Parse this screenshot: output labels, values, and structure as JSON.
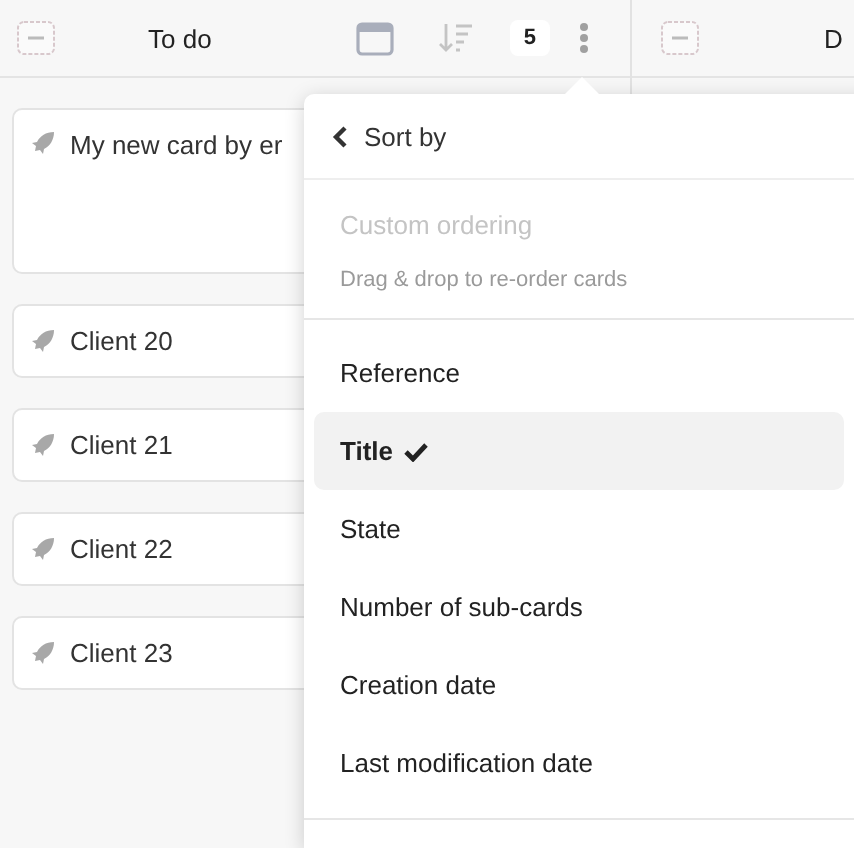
{
  "columns": [
    {
      "title": "To do",
      "count": "5",
      "cards": [
        {
          "title": "My new card by er",
          "tall": true
        },
        {
          "title": "Client 20",
          "tall": false
        },
        {
          "title": "Client 21",
          "tall": false
        },
        {
          "title": "Client 22",
          "tall": false
        },
        {
          "title": "Client 23",
          "tall": false
        }
      ]
    },
    {
      "title": "D"
    }
  ],
  "sort_menu": {
    "title": "Sort by",
    "custom": {
      "label": "Custom ordering",
      "disabled": true,
      "hint": "Drag & drop to re-order cards"
    },
    "options": [
      {
        "label": "Reference",
        "selected": false
      },
      {
        "label": "Title",
        "selected": true
      },
      {
        "label": "State",
        "selected": false
      },
      {
        "label": "Number of sub-cards",
        "selected": false
      },
      {
        "label": "Creation date",
        "selected": false
      },
      {
        "label": "Last modification date",
        "selected": false
      }
    ]
  }
}
